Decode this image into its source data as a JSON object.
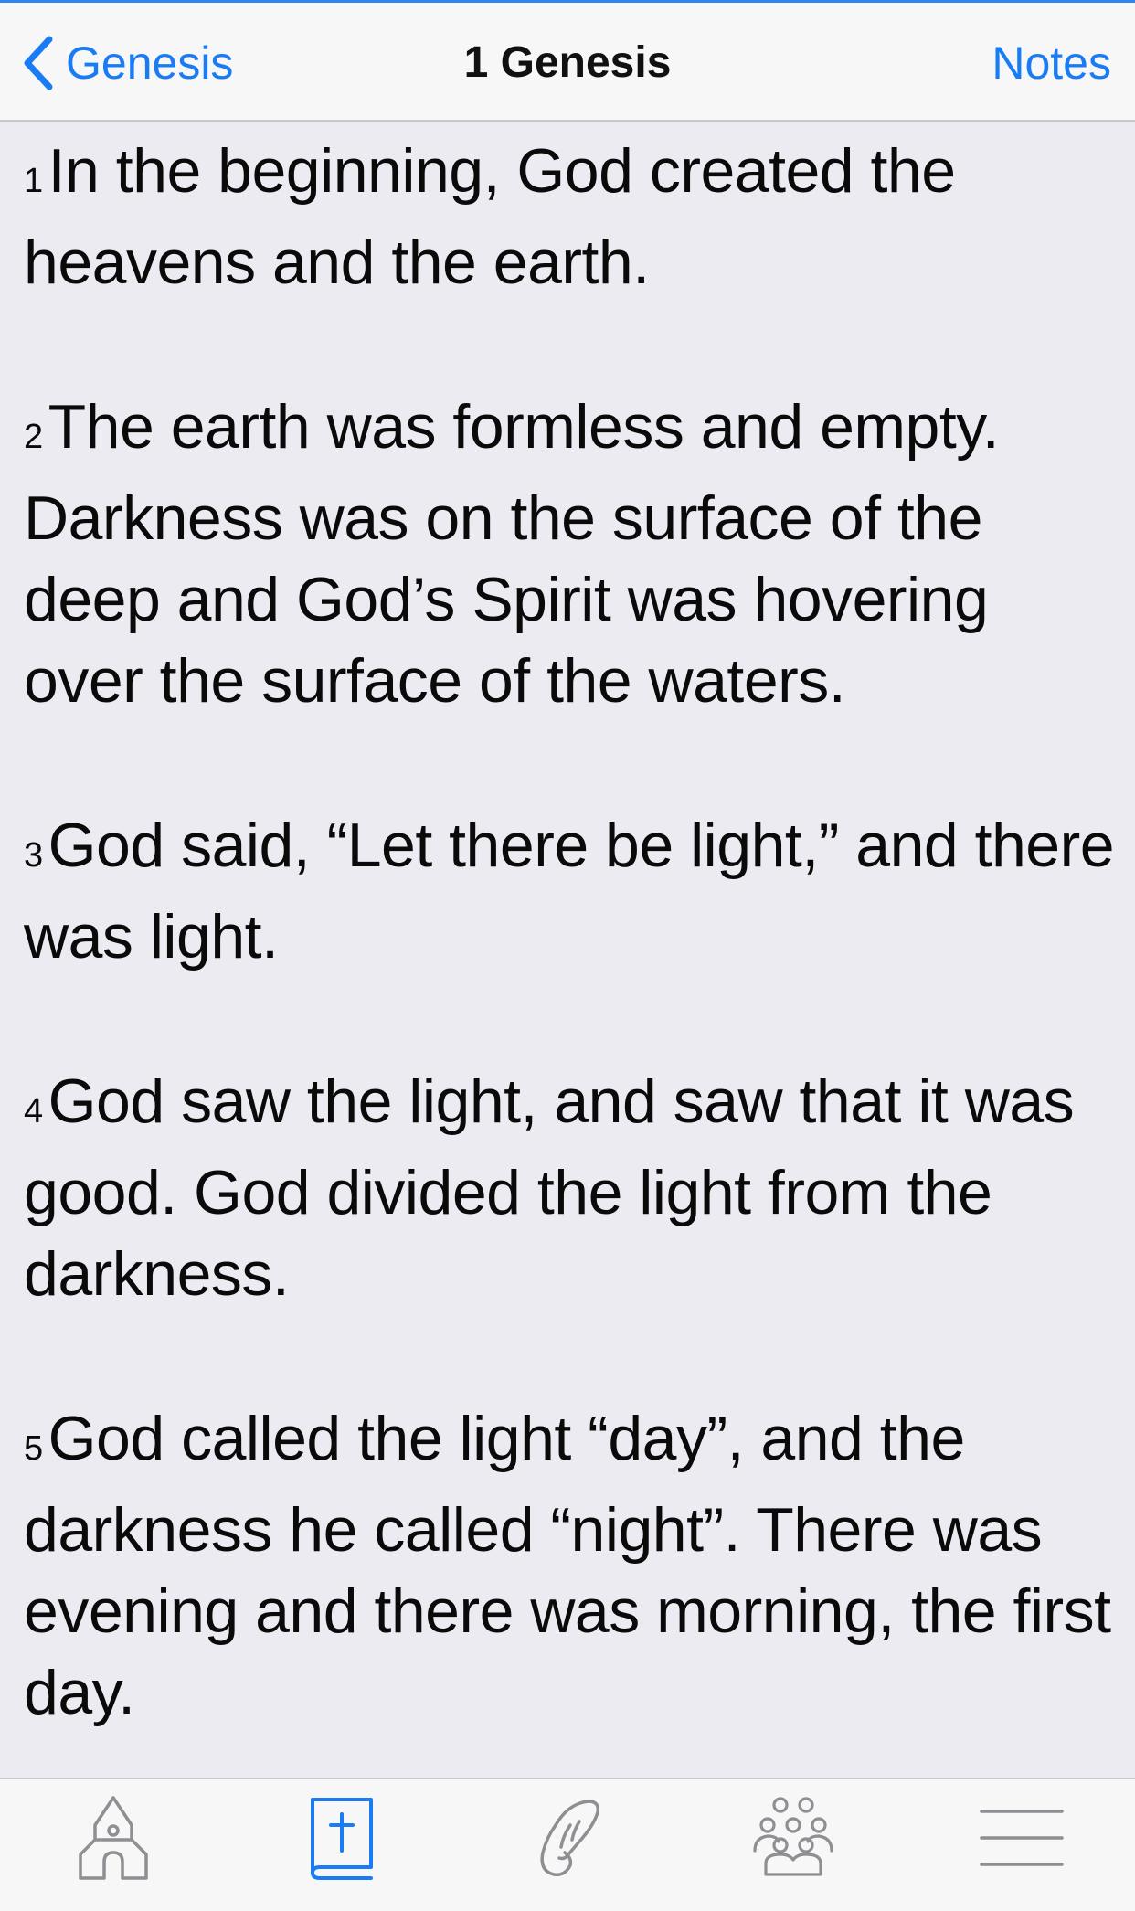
{
  "navbar": {
    "back_label": "Genesis",
    "title": "1 Genesis",
    "notes_label": "Notes"
  },
  "verses": [
    {
      "num": "1",
      "text": "In the beginning, God created the heavens and the earth."
    },
    {
      "num": "2",
      "text": "The earth was formless and empty. Darkness was on the surface of the deep and God’s Spirit was hovering over the surface of the waters."
    },
    {
      "num": "3",
      "text": "God said, “Let there be light,” and there was light."
    },
    {
      "num": "4",
      "text": "God saw the light, and saw that it was good. God divided the light from the darkness."
    },
    {
      "num": "5",
      "text": "God called the light “day”, and the darkness he called “night”. There was evening and there was morning, the first day."
    }
  ],
  "tabbar": {
    "items": [
      {
        "icon": "church-icon",
        "active": false
      },
      {
        "icon": "bible-icon",
        "active": true
      },
      {
        "icon": "prayer-hands-icon",
        "active": false
      },
      {
        "icon": "community-icon",
        "active": false
      },
      {
        "icon": "menu-icon",
        "active": false
      }
    ]
  },
  "colors": {
    "accent": "#1a7cf5",
    "inactive_icon": "#8e8e93",
    "background": "#ebebf1",
    "bar_background": "#f7f7f7"
  }
}
